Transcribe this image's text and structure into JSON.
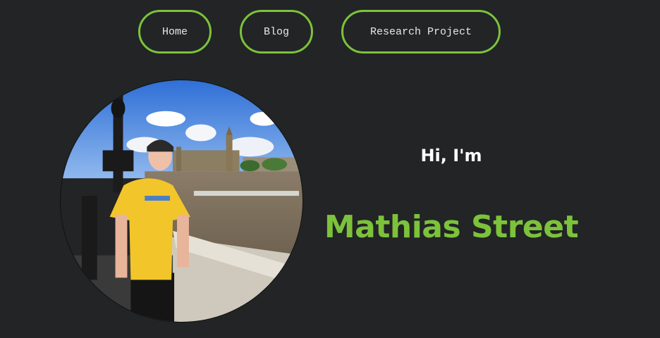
{
  "nav": {
    "items": [
      {
        "label": "Home"
      },
      {
        "label": "Blog"
      },
      {
        "label": "Research Project"
      }
    ]
  },
  "hero": {
    "greeting": "Hi, I'm",
    "name": "Mathias Street",
    "photo_icon": "profile-photo"
  },
  "colors": {
    "background": "#222426",
    "accent": "#7dc23b",
    "text": "#ffffff"
  }
}
